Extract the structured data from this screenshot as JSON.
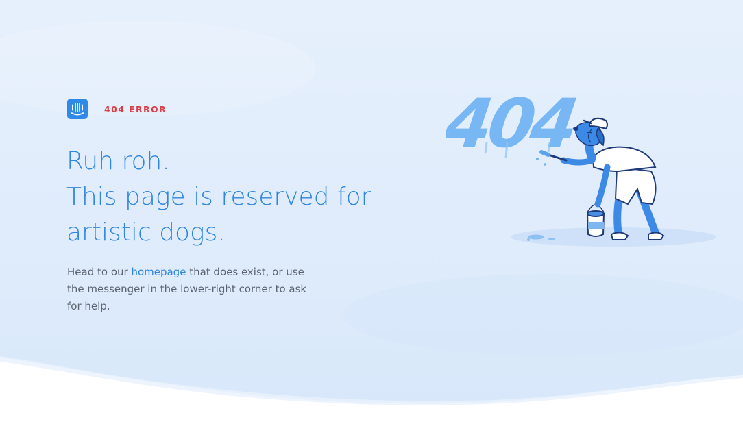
{
  "brand": {
    "logo_icon": "intercom-logo-icon",
    "error_label": "404 ERROR"
  },
  "headline": {
    "line1": "Ruh roh.",
    "line2": "This page is reserved for",
    "line3": "artistic dogs."
  },
  "body": {
    "prefix": "Head to our ",
    "link_text": "homepage",
    "suffix": " that does exist, or use the messenger in the lower-right corner to ask for help."
  },
  "illustration": {
    "painted_text": "404",
    "icon": "dog-painting-icon"
  },
  "colors": {
    "accent": "#2f86e0",
    "error": "#d8404a",
    "background": "#e1edfb",
    "text": "#5b6470"
  }
}
